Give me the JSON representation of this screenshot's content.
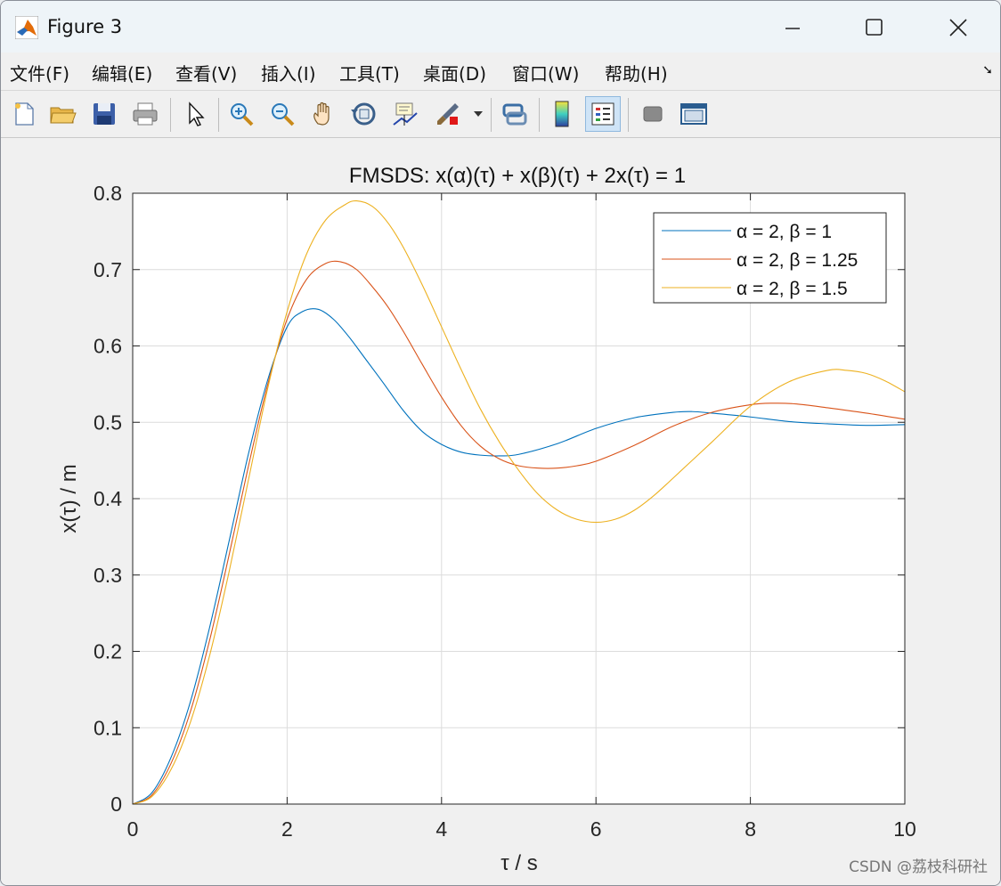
{
  "window": {
    "title": "Figure 3",
    "controls": [
      "minimize",
      "maximize",
      "close"
    ]
  },
  "menu": {
    "items": [
      "文件(F)",
      "编辑(E)",
      "查看(V)",
      "插入(I)",
      "工具(T)",
      "桌面(D)",
      "窗口(W)",
      "帮助(H)"
    ],
    "corner_glyph": "➘"
  },
  "toolbar": {
    "buttons": [
      {
        "name": "new-figure-icon"
      },
      {
        "name": "open-file-icon"
      },
      {
        "name": "save-icon"
      },
      {
        "name": "print-icon"
      },
      {
        "name": "edit-plot-icon"
      },
      {
        "name": "zoom-in-icon"
      },
      {
        "name": "zoom-out-icon"
      },
      {
        "name": "pan-icon"
      },
      {
        "name": "rotate-3d-icon"
      },
      {
        "name": "data-cursor-icon"
      },
      {
        "name": "brush-icon"
      },
      {
        "name": "link-plot-icon"
      },
      {
        "name": "colorbar-icon"
      },
      {
        "name": "legend-icon",
        "active": true
      },
      {
        "name": "hide-plot-tools-icon"
      },
      {
        "name": "show-plot-tools-icon"
      }
    ]
  },
  "chart_data": {
    "type": "line",
    "title": "FMSDS: x(α)(τ) + x(β)(τ) + 2x(τ) = 1",
    "xlabel": "τ / s",
    "ylabel": "x(τ) / m",
    "xlim": [
      0,
      10
    ],
    "ylim": [
      0,
      0.8
    ],
    "xticks": [
      0,
      2,
      4,
      6,
      8,
      10
    ],
    "yticks": [
      0,
      0.1,
      0.2,
      0.3,
      0.4,
      0.5,
      0.6,
      0.7,
      0.8
    ],
    "grid": true,
    "legend_position": "top-right",
    "series": [
      {
        "name": "α = 2, β = 1",
        "color": "#0072BD",
        "x": [
          0,
          0.25,
          0.5,
          0.75,
          1.0,
          1.25,
          1.5,
          1.75,
          2.0,
          2.2,
          2.4,
          2.6,
          2.8,
          3.0,
          3.25,
          3.5,
          3.75,
          4.0,
          4.25,
          4.5,
          4.75,
          5.0,
          5.5,
          6.0,
          6.5,
          7.0,
          7.25,
          7.5,
          8.0,
          8.5,
          9.0,
          9.5,
          10.0
        ],
        "y": [
          0,
          0.015,
          0.062,
          0.135,
          0.233,
          0.345,
          0.459,
          0.556,
          0.625,
          0.645,
          0.648,
          0.635,
          0.612,
          0.585,
          0.551,
          0.516,
          0.488,
          0.471,
          0.461,
          0.457,
          0.456,
          0.458,
          0.472,
          0.492,
          0.506,
          0.513,
          0.514,
          0.512,
          0.507,
          0.501,
          0.498,
          0.496,
          0.497
        ]
      },
      {
        "name": "α = 2, β = 1.25",
        "color": "#D95319",
        "x": [
          0,
          0.25,
          0.5,
          0.75,
          1.0,
          1.25,
          1.5,
          1.75,
          2.0,
          2.25,
          2.5,
          2.7,
          2.9,
          3.1,
          3.3,
          3.5,
          3.75,
          4.0,
          4.25,
          4.5,
          4.75,
          5.0,
          5.25,
          5.5,
          5.75,
          6.0,
          6.5,
          7.0,
          7.5,
          8.0,
          8.3,
          8.6,
          9.0,
          9.5,
          10.0
        ],
        "y": [
          0,
          0.012,
          0.054,
          0.122,
          0.216,
          0.327,
          0.443,
          0.55,
          0.635,
          0.687,
          0.708,
          0.71,
          0.7,
          0.678,
          0.652,
          0.62,
          0.576,
          0.533,
          0.496,
          0.469,
          0.452,
          0.443,
          0.44,
          0.44,
          0.443,
          0.449,
          0.47,
          0.495,
          0.513,
          0.523,
          0.525,
          0.524,
          0.519,
          0.512,
          0.504
        ]
      },
      {
        "name": "α = 2, β = 1.5",
        "color": "#EDB120",
        "x": [
          0,
          0.25,
          0.5,
          0.75,
          1.0,
          1.25,
          1.5,
          1.75,
          2.0,
          2.25,
          2.5,
          2.75,
          2.9,
          3.1,
          3.3,
          3.5,
          3.75,
          4.0,
          4.25,
          4.5,
          4.75,
          5.0,
          5.25,
          5.5,
          5.75,
          6.0,
          6.25,
          6.5,
          6.75,
          7.0,
          7.5,
          8.0,
          8.5,
          9.0,
          9.25,
          9.5,
          9.75,
          10.0
        ],
        "y": [
          0,
          0.01,
          0.046,
          0.108,
          0.196,
          0.305,
          0.425,
          0.545,
          0.645,
          0.72,
          0.765,
          0.785,
          0.79,
          0.783,
          0.762,
          0.73,
          0.68,
          0.625,
          0.57,
          0.518,
          0.474,
          0.437,
          0.406,
          0.385,
          0.373,
          0.369,
          0.373,
          0.385,
          0.404,
          0.427,
          0.474,
          0.521,
          0.553,
          0.568,
          0.568,
          0.564,
          0.554,
          0.54
        ]
      }
    ]
  },
  "watermark": "CSDN @荔枝科研社"
}
